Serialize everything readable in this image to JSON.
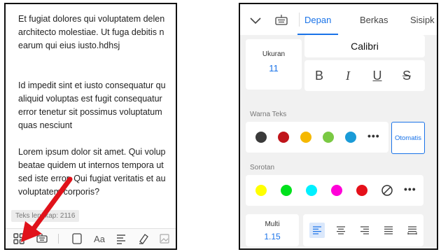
{
  "left": {
    "paragraphs": [
      [
        "Et fugiat dolores qui voluptatem delen",
        "architecto molestiae. Ut fuga debitis n",
        "earum qui eius iusto.hdhsj"
      ],
      [
        "Id impedit sint et iusto consequatur qu",
        "aliquid voluptas est fugit consequatur",
        "error tenetur sit possimus voluptatum",
        "quas nesciunt"
      ],
      [
        "Lorem ipsum dolor sit amet. Qui volup",
        "beatae quidem ut internos tempora ut",
        "sed iste error. Qui fugiat veritatis et au",
        "voluptatem corporis?"
      ]
    ],
    "word_count": "Teks lengkap: 2116",
    "toolbar_icons": [
      "grid-icon",
      "keyboard-icon",
      "page-layout-icon",
      "font-size-icon",
      "paragraph-align-icon",
      "highlighter-icon",
      "image-icon"
    ],
    "toolbar_font_glyph": "Aa"
  },
  "right": {
    "tabs": [
      "Depan",
      "Berkas",
      "Sisipk"
    ],
    "active_tab": "Depan",
    "font_size": {
      "label": "Ukuran",
      "value": "11"
    },
    "font_name": "Calibri",
    "format_buttons": [
      "B",
      "I",
      "U",
      "S"
    ],
    "text_color_label": "Warna Teks",
    "text_colors": [
      "#3a3a3a",
      "#c0141a",
      "#f5b800",
      "#7ac943",
      "#1a9bd7"
    ],
    "auto_label": "Otomatis",
    "highlight_label": "Sorotan",
    "highlight_colors": [
      "#ffff00",
      "#00e11c",
      "#00f0ff",
      "#ff00d8",
      "#e5101a"
    ],
    "more_label": "•••",
    "line_spacing": {
      "label": "Multi",
      "value": "1.15"
    },
    "align_buttons": [
      "align-left-icon",
      "align-center-icon",
      "align-right-icon",
      "justify-icon",
      "distribute-icon"
    ],
    "accent_color": "#1a73e8"
  }
}
